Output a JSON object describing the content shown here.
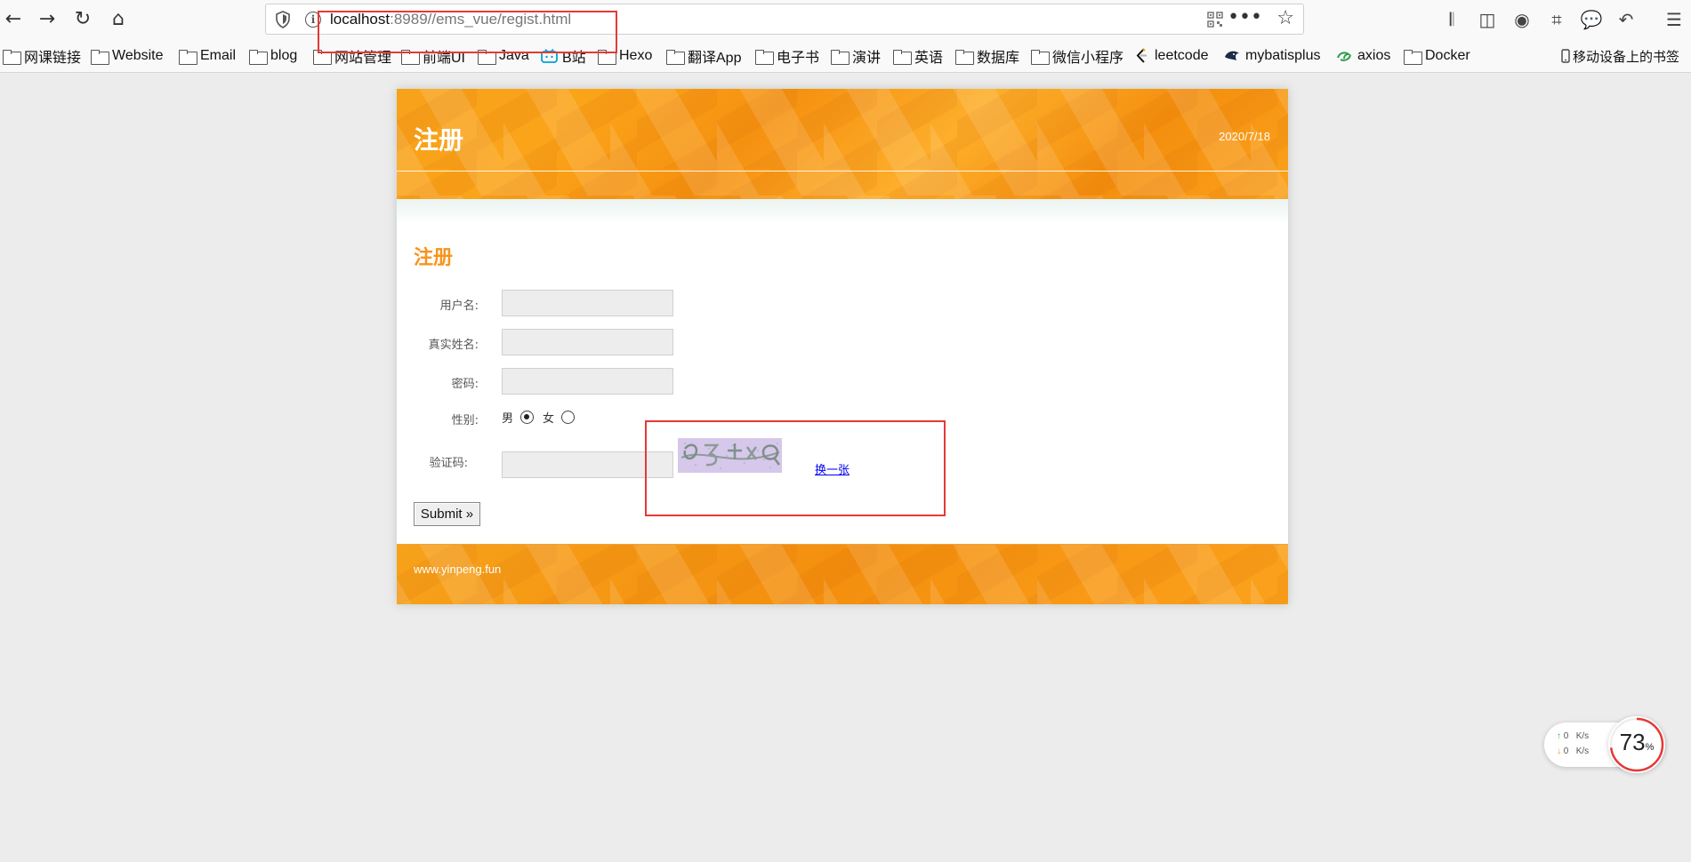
{
  "browser": {
    "url_host": "localhost",
    "url_rest": ":8989//ems_vue/regist.html",
    "bookmarks": [
      {
        "label": "网课链接",
        "icon": "folder-icon"
      },
      {
        "label": "Website",
        "icon": "folder-icon"
      },
      {
        "label": "Email",
        "icon": "folder-icon"
      },
      {
        "label": "blog",
        "icon": "folder-icon"
      },
      {
        "label": "网站管理",
        "icon": "folder-icon"
      },
      {
        "label": "前端UI",
        "icon": "folder-icon"
      },
      {
        "label": "Java",
        "icon": "folder-icon"
      },
      {
        "label": "B站",
        "icon": "bilibili-icon"
      },
      {
        "label": "Hexo",
        "icon": "folder-icon"
      },
      {
        "label": "翻译App",
        "icon": "folder-icon"
      },
      {
        "label": "电子书",
        "icon": "folder-icon"
      },
      {
        "label": "演讲",
        "icon": "folder-icon"
      },
      {
        "label": "英语",
        "icon": "folder-icon"
      },
      {
        "label": "数据库",
        "icon": "folder-icon"
      },
      {
        "label": "微信小程序",
        "icon": "folder-icon"
      },
      {
        "label": "leetcode",
        "icon": "leetcode-icon"
      },
      {
        "label": "mybatisplus",
        "icon": "mybatisplus-icon"
      },
      {
        "label": "axios",
        "icon": "axios-icon"
      },
      {
        "label": "Docker",
        "icon": "folder-icon"
      }
    ],
    "mobile_bookmarks": "移动设备上的书签"
  },
  "page": {
    "header_title": "注册",
    "header_date": "2020/7/18",
    "content_title": "注册",
    "form": {
      "username_label": "用户名:",
      "realname_label": "真实姓名:",
      "password_label": "密码:",
      "gender_label": "性别:",
      "gender_male": "男",
      "gender_female": "女",
      "captcha_label": "验证码:",
      "captcha_refresh": "换一张",
      "submit_label": "Submit »"
    },
    "footer_text": "www.yinpeng.fun"
  },
  "speed_widget": {
    "up": "0",
    "down": "0",
    "unit": "K/s",
    "percent": "73",
    "percent_sign": "%"
  },
  "colors": {
    "accent": "#f7941d",
    "highlight_box": "#e53935",
    "link": "#0000ee"
  }
}
